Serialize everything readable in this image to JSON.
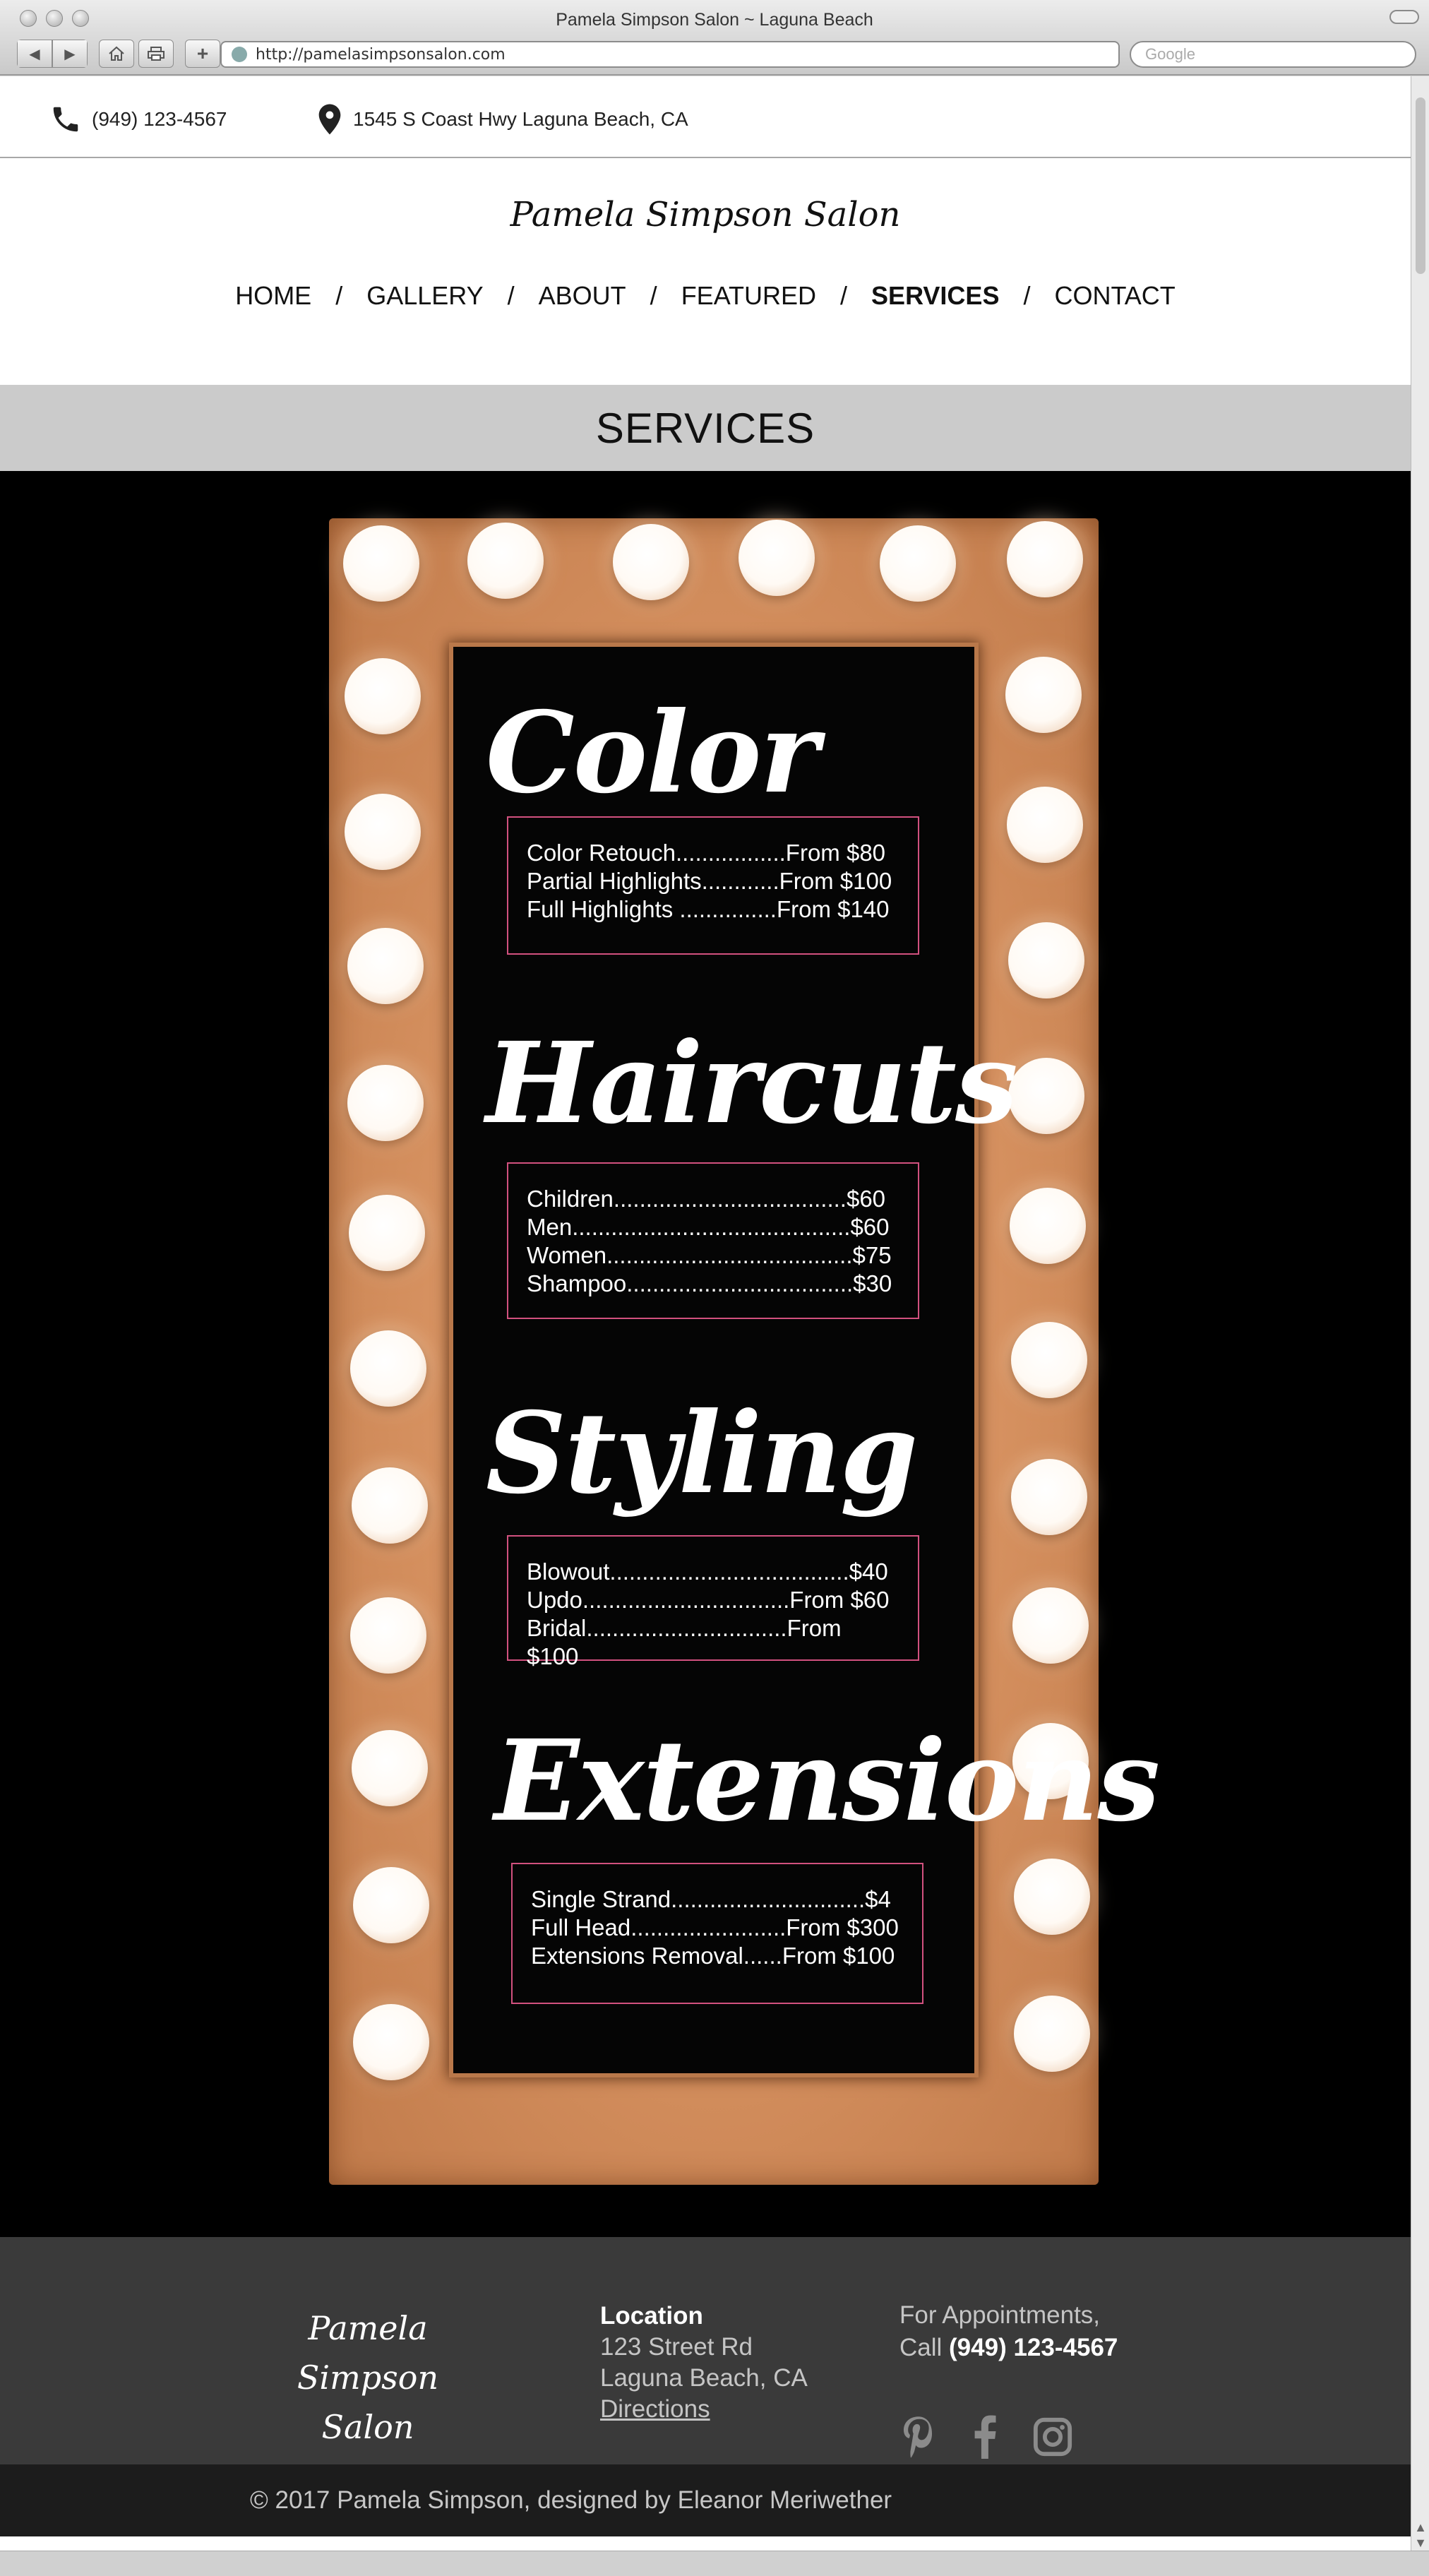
{
  "window": {
    "title": "Pamela Simpson Salon ~ Laguna Beach",
    "url": "http://pamelasimpsonsalon.com",
    "search_placeholder": "Google"
  },
  "topbar": {
    "phone": "(949) 123-4567",
    "address": "1545 S Coast Hwy Laguna Beach, CA"
  },
  "brand": "Pamela Simpson Salon",
  "nav": {
    "items": [
      {
        "label": "HOME"
      },
      {
        "label": "GALLERY"
      },
      {
        "label": "ABOUT"
      },
      {
        "label": "FEATURED"
      },
      {
        "label": "SERVICES",
        "active": true
      },
      {
        "label": "CONTACT"
      }
    ],
    "separator": "/"
  },
  "page_heading": "SERVICES",
  "services": [
    {
      "title": "Color",
      "lines": [
        "Color Retouch.................From $80",
        "Partial Highlights............From $100",
        "Full Highlights ...............From $140"
      ]
    },
    {
      "title": "Haircuts",
      "lines": [
        "Children....................................$60",
        "Men...........................................$60",
        "Women......................................$75",
        "Shampoo...................................$30"
      ]
    },
    {
      "title": "Styling",
      "lines": [
        "Blowout.....................................$40",
        "Updo................................From $60",
        "Bridal...............................From $100"
      ]
    },
    {
      "title": "Extensions",
      "lines": [
        "Single Strand..............................$4",
        "Full Head........................From $300",
        "Extensions Removal......From $100"
      ]
    }
  ],
  "footer": {
    "brand_line1": "Pamela Simpson",
    "brand_line2": "Salon",
    "location_heading": "Location",
    "street": "123 Street Rd",
    "city": "Laguna Beach, CA",
    "directions": "Directions",
    "appt_line1": "For Appointments,",
    "appt_call": "Call",
    "appt_phone": "(949) 123-4567",
    "social": [
      "pinterest-icon",
      "facebook-icon",
      "instagram-icon"
    ],
    "copyright": "© 2017 Pamela Simpson, designed by Eleanor Meriwether"
  },
  "colors": {
    "accent_border": "#d2517f",
    "services_band": "#cbcbcb",
    "footer_bg": "#3a3a3a",
    "copyright_bg": "#1c1c1c"
  }
}
